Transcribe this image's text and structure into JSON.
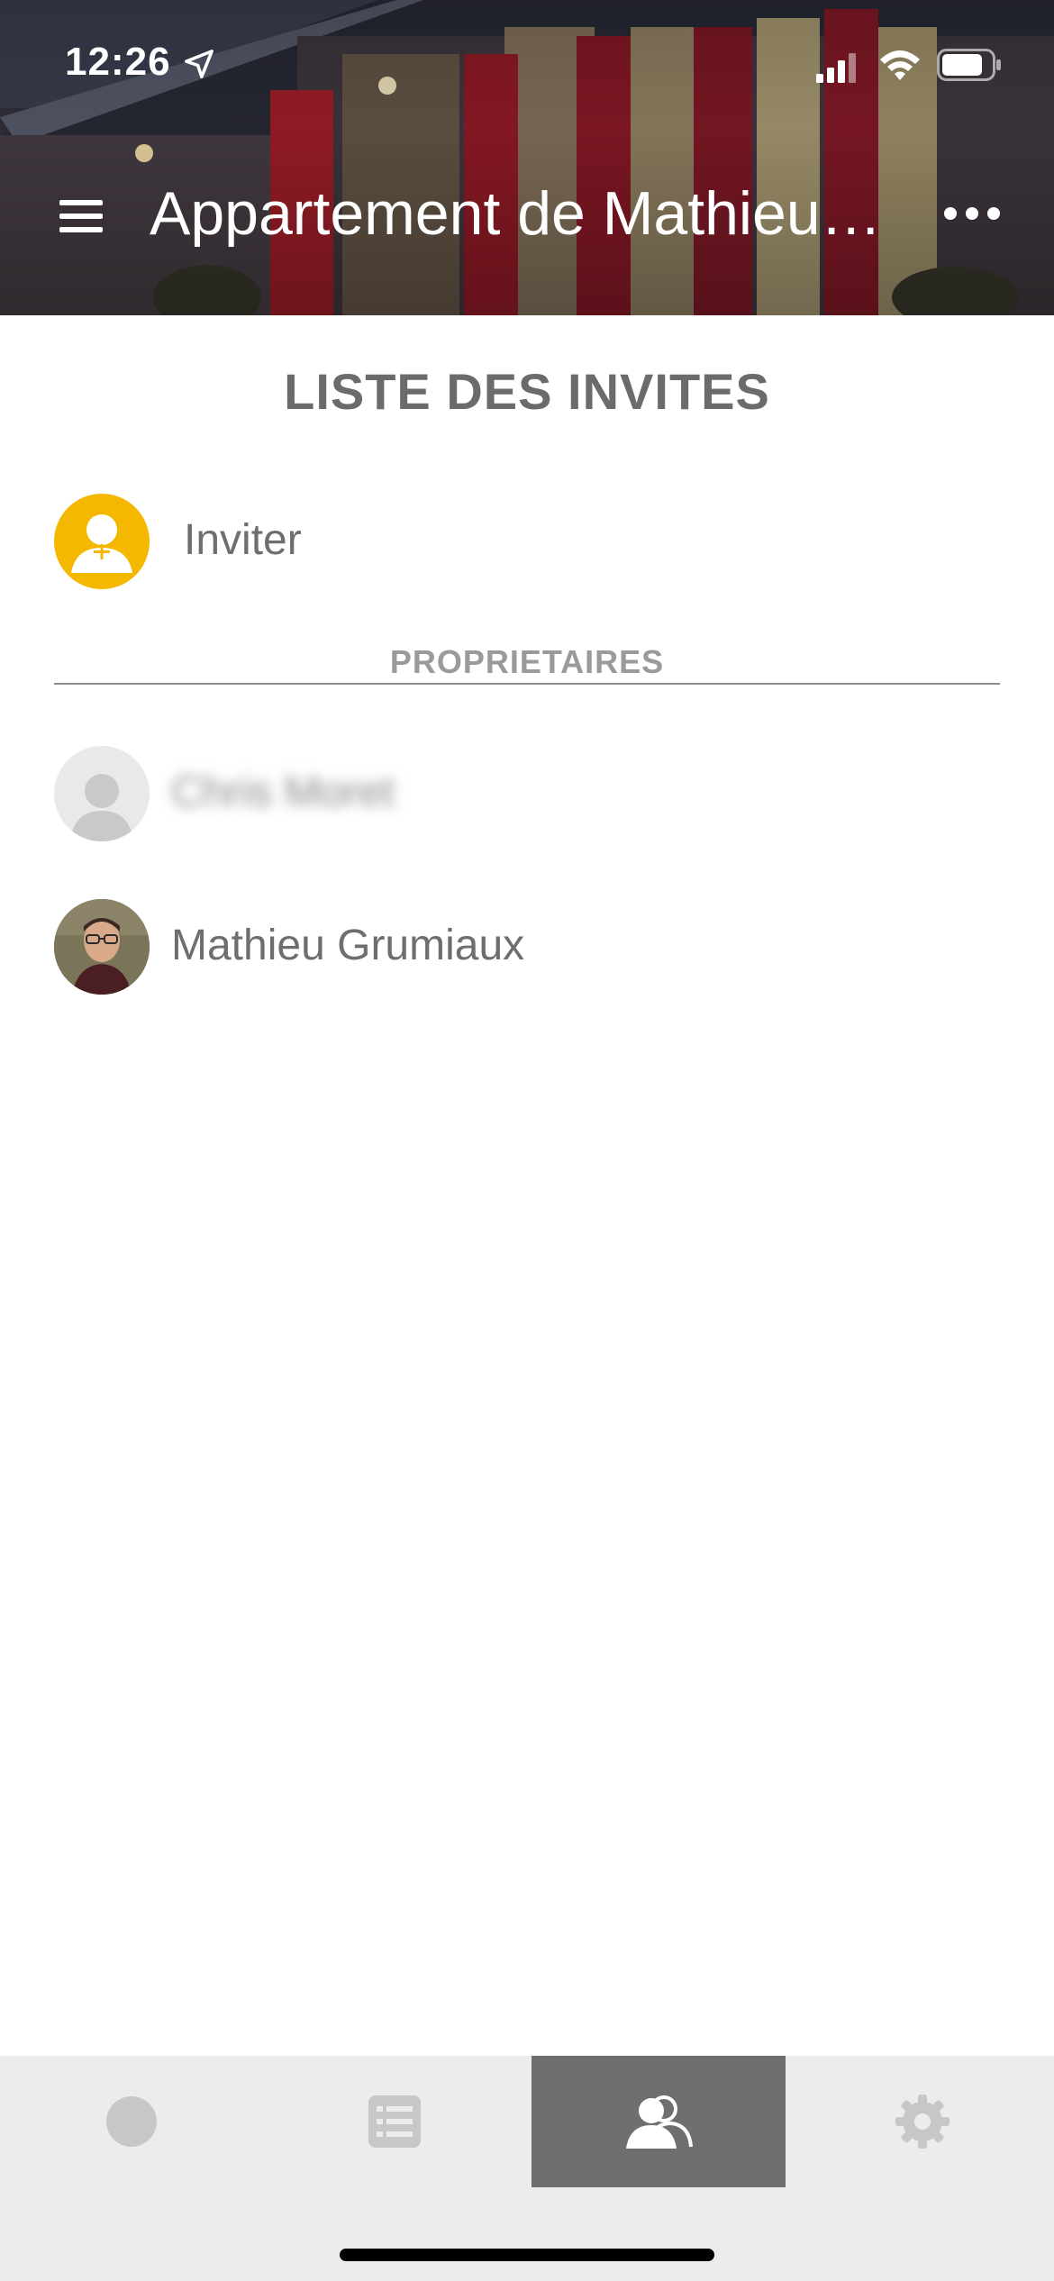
{
  "status_bar": {
    "time": "12:26",
    "icons": [
      "location-arrow-icon",
      "cellular-signal-icon",
      "wifi-icon",
      "battery-icon"
    ]
  },
  "header": {
    "title": "Appartement de Mathieu…",
    "menu_icon": "hamburger-menu-icon",
    "more_icon": "more-dots-icon"
  },
  "guests": {
    "section_title": "LISTE DES INVITES",
    "invite_label": "Inviter",
    "invite_icon": "add-user-icon",
    "owners_heading": "PROPRIETAIRES",
    "owners": [
      {
        "name": "Chris Moret",
        "avatar": "default-avatar-icon",
        "blurred": true
      },
      {
        "name": "Mathieu Grumiaux",
        "avatar": "profile-photo"
      }
    ]
  },
  "tab_bar": {
    "tabs": [
      {
        "icon": "circle-icon",
        "active": false
      },
      {
        "icon": "list-icon",
        "active": false
      },
      {
        "icon": "users-icon",
        "active": true
      },
      {
        "icon": "gear-icon",
        "active": false
      }
    ]
  },
  "colors": {
    "accent": "#f5b800",
    "active_tab": "#6f6f6f",
    "tab_bar_bg": "#ececec",
    "text": "#6e6e6e"
  }
}
